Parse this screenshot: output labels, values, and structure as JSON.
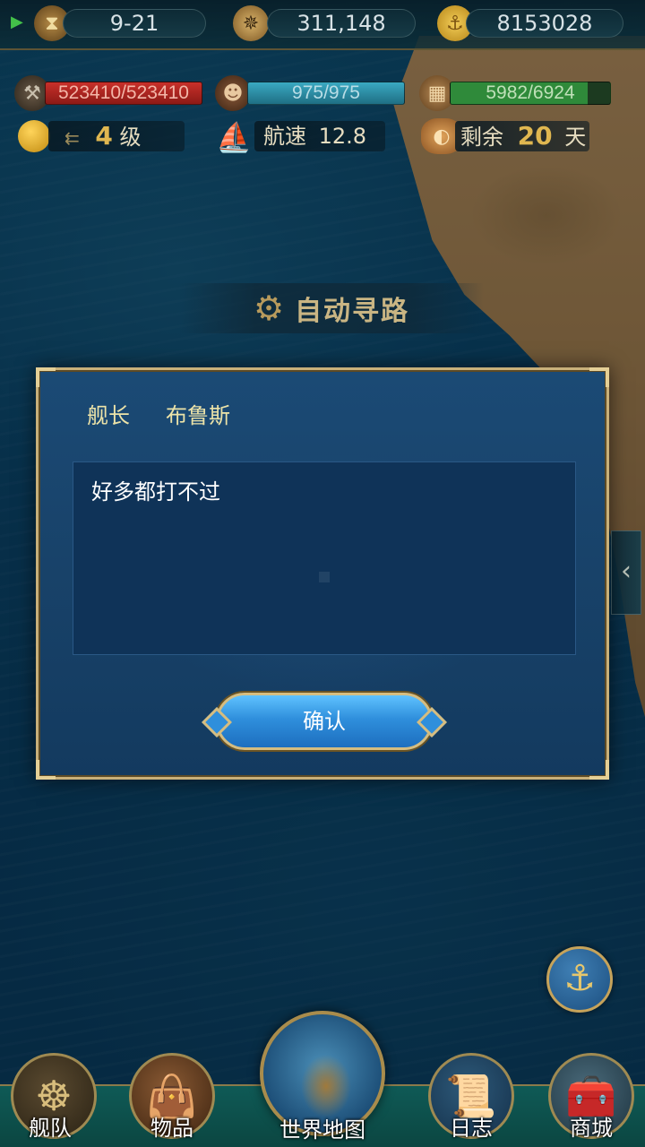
{
  "top_bar": {
    "date": "9-21",
    "gold": "311,148",
    "coins": "8153028"
  },
  "stats": {
    "durability": "523410/523410",
    "crew": "975/975",
    "cargo": "5982/6924"
  },
  "info": {
    "level_value": "4",
    "level_unit": "级",
    "speed_label": "航速",
    "speed_value": "12.8",
    "remaining_label": "剩余",
    "remaining_value": "20",
    "remaining_unit": "天"
  },
  "auto_path": {
    "label": "自动寻路"
  },
  "dialog": {
    "speaker_title": "舰长",
    "speaker_name": "布鲁斯",
    "message": "好多都打不过",
    "confirm_label": "确认"
  },
  "bottom_nav": {
    "fleet": "舰队",
    "items": "物品",
    "world_map": "世界地图",
    "log": "日志",
    "shop": "商城"
  },
  "colors": {
    "durability_bar": "#a8231f",
    "crew_bar": "#2a8ea6",
    "cargo_bar": "#2f8a3a",
    "dialog_bg": "#184269",
    "confirm_button": "#2f8fdc",
    "speaker_text": "#ece3a8"
  },
  "icons": {
    "date": "hourglass-icon",
    "gold": "compass-icon",
    "coins": "anchor-coin-icon",
    "durability": "hammer-icon",
    "crew": "sailor-icon",
    "cargo": "cargo-crate-icon",
    "level": "gold-orb-icon",
    "speed": "ship-icon",
    "remaining": "bread-icon",
    "auto_path": "gears-icon",
    "anchor_button": "anchor-icon",
    "side_tab": "chevron-left-icon"
  }
}
